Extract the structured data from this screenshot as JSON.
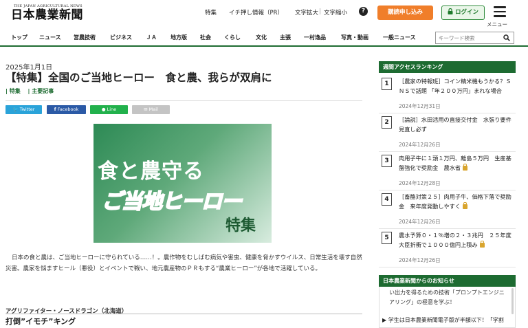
{
  "header": {
    "logo_en": "THE JAPAN AGRICULTURAL NEWS",
    "logo_jp": "日本農業新聞",
    "links": [
      "特集",
      "イチ押し情報（PR）",
      "文字拡大",
      "文字縮小"
    ],
    "help_icon": "?",
    "subscribe_label": "購読申し込み",
    "login_label": "ログイン",
    "menu_label": "メニュー"
  },
  "nav": {
    "items": [
      "トップ",
      "ニュース",
      "営農技術",
      "ビジネス",
      "ＪＡ",
      "地方版",
      "社会",
      "くらし",
      "文化",
      "主張",
      "一村逸品",
      "写真・動画",
      "一般ニュース"
    ],
    "search_placeholder": "キーワード検索"
  },
  "article": {
    "date": "2025年1月1日",
    "title": "【特集】全国のご当地ヒーロー　食と農、我らが双肩に",
    "tags": [
      "| 特集",
      "| 主要記事"
    ],
    "share": {
      "twitter": "Twitter",
      "facebook": "Facebook",
      "line": "Line",
      "mail": "Mail"
    },
    "hero": {
      "line1": "食と農守る",
      "line2": "ご当地ヒーロー",
      "line3": "特集"
    },
    "body": "日本の食と農は、ご当地ヒーローに守られている……！。農作物をむしばむ病気や害虫、健康を脅かすウイルス、日常生活を壊す自然災害。農家を悩ますヒール（悪役）とイベントで戦い、地元農産物のＰＲもする“農業ヒーロー”が各地で活躍している。",
    "subhead": "アグリファイター・ノースドラゴン（北海道）",
    "subtitle": "打倒”イモチ”キング"
  },
  "sidebar": {
    "ranking_title": "週間アクセスランキング",
    "ranking": [
      {
        "num": "1",
        "text": "［農家の特報班］コイン精米機もうかる？ＳＮＳで話題 「年２００万円」まれな場合",
        "date": "2024年12月31日",
        "locked": false
      },
      {
        "num": "2",
        "text": "［論説］水田活用の直接交付金　水張り要件見直し必ず",
        "date": "2024年12月26日",
        "locked": false
      },
      {
        "num": "3",
        "text": "肉用子牛に１頭１万円、離島５万円　生産基盤強化で奨励金　農水省",
        "date": "2024年12月28日",
        "locked": true
      },
      {
        "num": "4",
        "text": "［畜酪対策２５］肉用子牛、価格下落で奨励金　来年度発動しやすく",
        "date": "2024年12月26日",
        "locked": true
      },
      {
        "num": "5",
        "text": "農水予算０・１％増の２・３兆円　２５年度　大臣折衝で１０００億円上積み",
        "date": "2024年12月26日",
        "locked": true
      }
    ],
    "notice_title": "日本農業新聞からのお知らせ",
    "notice_1": "い出力を得るための技術「プロンプトエンジニアリング」の極意を学ぶ！",
    "notice_2": "▶ 学生は日本農業新聞電子版が半額以下！「学割"
  },
  "colors": {
    "brand_green": "#1d6b31",
    "subscribe_orange": "#f07e2a",
    "twitter": "#2aa3d9",
    "facebook": "#2b5aa6",
    "line": "#22b14c",
    "mail": "#c4c4c4"
  }
}
